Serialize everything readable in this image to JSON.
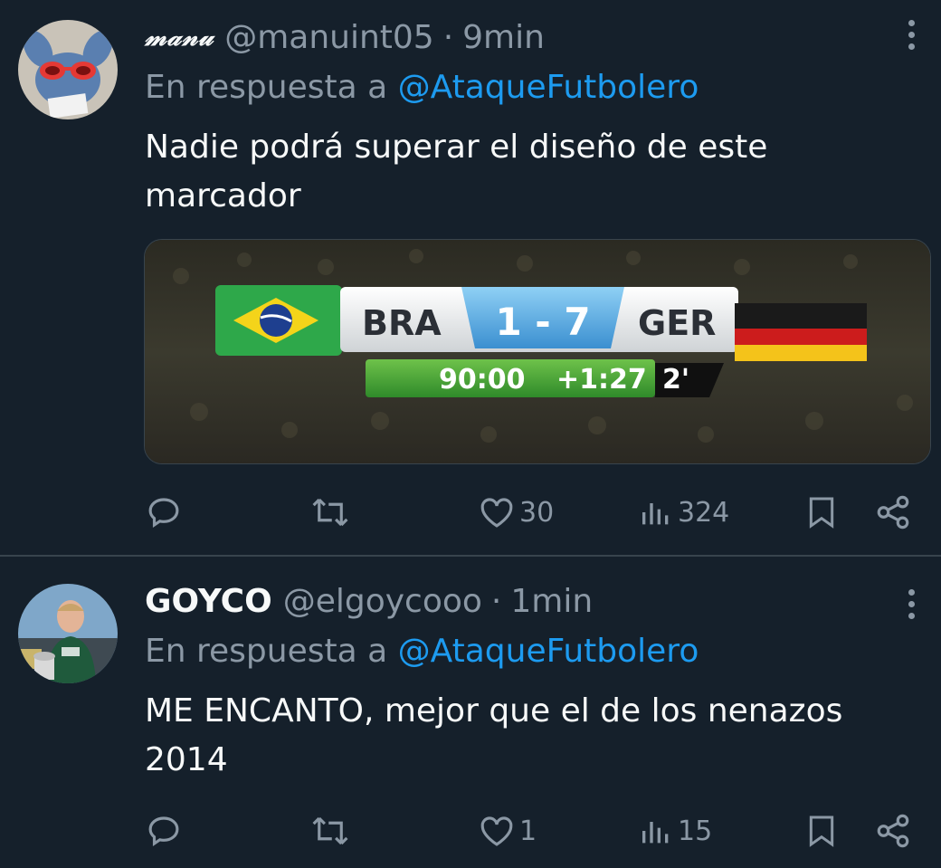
{
  "tweets": [
    {
      "display_name": "𝓂𝒶𝓃𝓊",
      "handle": "@manuint05",
      "time": "9min",
      "reply_prefix": "En respuesta a",
      "reply_to": "@AtaqueFutbolero",
      "text": "Nadie podrá superar el diseño de este marcador",
      "media": {
        "home_team": "BRA",
        "score": "1 - 7",
        "away_team": "GER",
        "clock": "90:00",
        "added_time": "+1:27",
        "extra": "2'"
      },
      "likes": "30",
      "views": "324"
    },
    {
      "display_name": "GOYCO",
      "handle": "@elgoycooo",
      "time": "1min",
      "reply_prefix": "En respuesta a",
      "reply_to": "@AtaqueFutbolero",
      "text": "ME ENCANTO, mejor que el de los nenazos 2014",
      "likes": "1",
      "views": "15"
    }
  ],
  "colors": {
    "background": "#15202b",
    "text": "#f7f9f9",
    "muted": "#8b98a5",
    "accent": "#1d9bf0",
    "divider": "#38444d"
  },
  "icons": [
    "reply-icon",
    "retweet-icon",
    "heart-icon",
    "views-icon",
    "bookmark-icon",
    "share-icon",
    "more-icon"
  ]
}
